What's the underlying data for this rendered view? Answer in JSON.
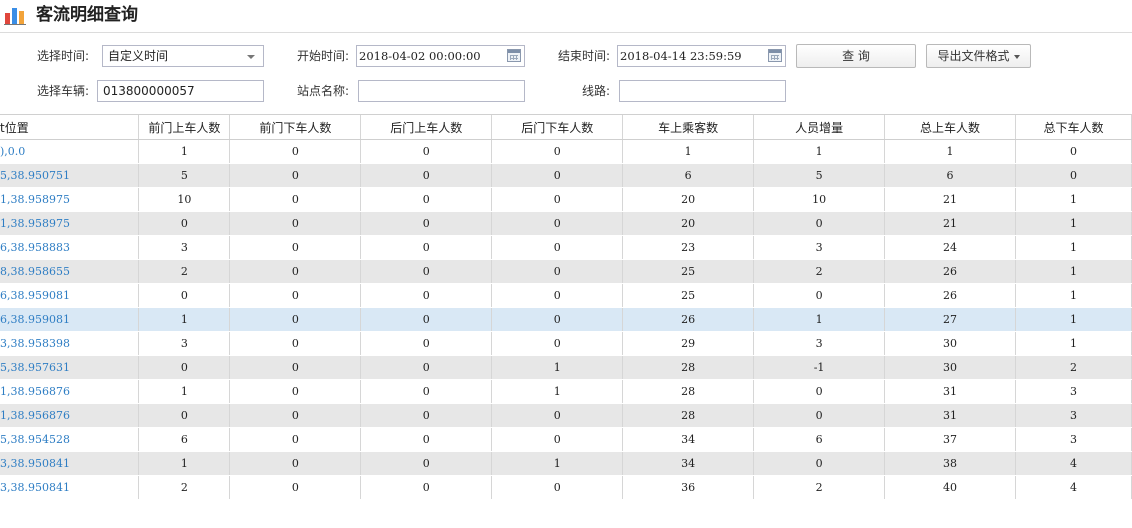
{
  "header": {
    "title": "客流明细查询"
  },
  "filters": {
    "time_select_label": "选择时间:",
    "time_select_value": "自定义时间",
    "start_label": "开始时间:",
    "start_value": "2018-04-02 00:00:00",
    "end_label": "结束时间:",
    "end_value": "2018-04-14 23:59:59",
    "vehicle_label": "选择车辆:",
    "vehicle_value": "013800000057",
    "station_label": "站点名称:",
    "station_value": "",
    "route_label": "线路:",
    "route_value": ""
  },
  "buttons": {
    "query": "查  询",
    "export": "导出文件格式"
  },
  "table": {
    "columns": [
      "t位置",
      "前门上车人数",
      "前门下车人数",
      "后门上车人数",
      "后门下车人数",
      "车上乘客数",
      "人员增量",
      "总上车人数",
      "总下车人数"
    ],
    "rows": [
      [
        "),0.0",
        "1",
        "0",
        "0",
        "0",
        "1",
        "1",
        "1",
        "0"
      ],
      [
        "5,38.950751",
        "5",
        "0",
        "0",
        "0",
        "6",
        "5",
        "6",
        "0"
      ],
      [
        "1,38.958975",
        "10",
        "0",
        "0",
        "0",
        "20",
        "10",
        "21",
        "1"
      ],
      [
        "1,38.958975",
        "0",
        "0",
        "0",
        "0",
        "20",
        "0",
        "21",
        "1"
      ],
      [
        "6,38.958883",
        "3",
        "0",
        "0",
        "0",
        "23",
        "3",
        "24",
        "1"
      ],
      [
        "8,38.958655",
        "2",
        "0",
        "0",
        "0",
        "25",
        "2",
        "26",
        "1"
      ],
      [
        "6,38.959081",
        "0",
        "0",
        "0",
        "0",
        "25",
        "0",
        "26",
        "1"
      ],
      [
        "6,38.959081",
        "1",
        "0",
        "0",
        "0",
        "26",
        "1",
        "27",
        "1"
      ],
      [
        "3,38.958398",
        "3",
        "0",
        "0",
        "0",
        "29",
        "3",
        "30",
        "1"
      ],
      [
        "5,38.957631",
        "0",
        "0",
        "0",
        "1",
        "28",
        "-1",
        "30",
        "2"
      ],
      [
        "1,38.956876",
        "1",
        "0",
        "0",
        "1",
        "28",
        "0",
        "31",
        "3"
      ],
      [
        "1,38.956876",
        "0",
        "0",
        "0",
        "0",
        "28",
        "0",
        "31",
        "3"
      ],
      [
        "5,38.954528",
        "6",
        "0",
        "0",
        "0",
        "34",
        "6",
        "37",
        "3"
      ],
      [
        "3,38.950841",
        "1",
        "0",
        "0",
        "1",
        "34",
        "0",
        "38",
        "4"
      ],
      [
        "3,38.950841",
        "2",
        "0",
        "0",
        "0",
        "36",
        "2",
        "40",
        "4"
      ]
    ],
    "selected_row": 7
  }
}
